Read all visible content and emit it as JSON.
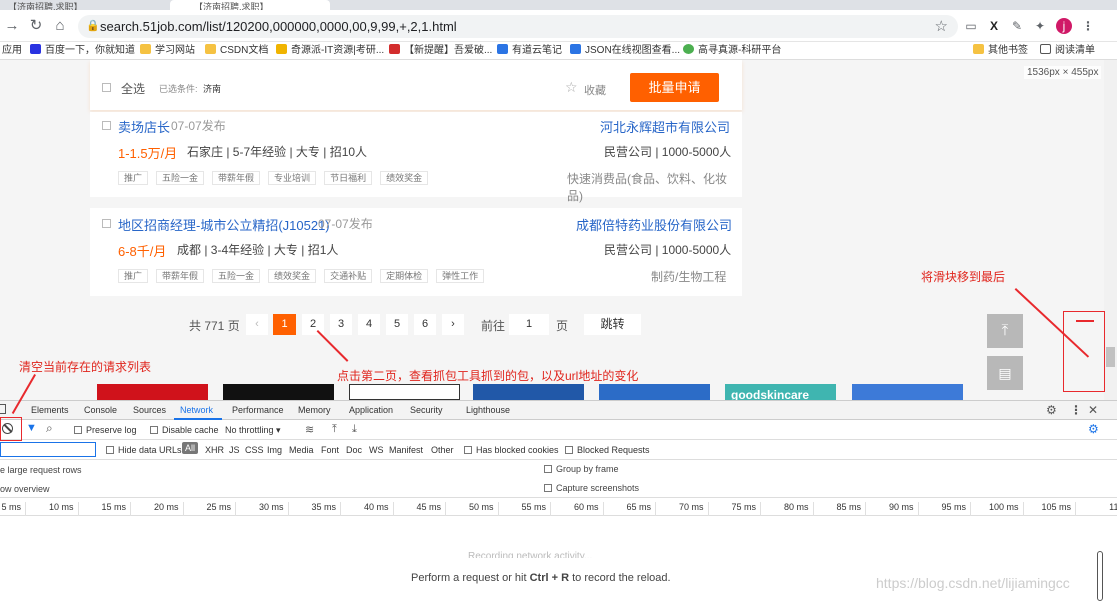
{
  "browser": {
    "tabs": [
      "【济南招聘,求职】",
      "【济南招聘,求职】"
    ],
    "url": "search.51job.com/list/120200,000000,0000,00,9,99,+,2,1.html",
    "profile_initial": "j",
    "bookmarks": [
      "应用",
      "百度一下，你就知道",
      "学习网站",
      "CSDN文档",
      "奇源派-IT资源|考研...",
      "【新提醒】吾爱破...",
      "有道云笔记",
      "JSON在线视图查看...",
      "高寻真源-科研平台",
      "其他书签",
      "阅读清单"
    ],
    "viewport_size": "1536px × 455px"
  },
  "page": {
    "select_all": "全选",
    "filter_label": "已选条件:",
    "filter_value": "济南",
    "favorite": "收藏",
    "batch_apply": "批量申请",
    "jobs": [
      {
        "title": "卖场店长",
        "date": "07-07发布",
        "company": "河北永辉超市有限公司",
        "salary": "1-1.5万/月",
        "info": "石家庄 | 5-7年经验 | 大专 | 招10人",
        "company_info": "民营公司 | 1000-5000人",
        "tags": [
          "推广",
          "五险一金",
          "带薪年假",
          "专业培训",
          "节日福利",
          "绩效奖金"
        ],
        "industry": "快速消费品(食品、饮料、化妆品)"
      },
      {
        "title": "地区招商经理-城市公立精招(J10521)",
        "date": "07-07发布",
        "company": "成都倍特药业股份有限公司",
        "salary": "6-8千/月",
        "info": "成都 | 3-4年经验 | 大专 | 招1人",
        "company_info": "民营公司 | 1000-5000人",
        "tags": [
          "推广",
          "带薪年假",
          "五险一金",
          "绩效奖金",
          "交通补贴",
          "定期体检",
          "弹性工作"
        ],
        "industry": "制药/生物工程"
      }
    ],
    "pagination": {
      "total": "共 771 页",
      "prev": "‹",
      "pages": [
        "1",
        "2",
        "3",
        "4",
        "5",
        "6"
      ],
      "current": "1",
      "next": "›",
      "goto_label": "前往",
      "goto_value": "1",
      "page_unit": "页",
      "jump": "跳转"
    },
    "banner_text": "goodskincare"
  },
  "annotations": {
    "slider": "将滑块移到最后",
    "page2": "点击第二页，查看抓包工具抓到的包，以及url地址的变化",
    "clear": "清空当前存在的请求列表"
  },
  "devtools": {
    "tabs": [
      "Elements",
      "Console",
      "Sources",
      "Network",
      "Performance",
      "Memory",
      "Application",
      "Security",
      "Lighthouse"
    ],
    "active_tab": "Network",
    "preserve_log": "Preserve log",
    "disable_cache": "Disable cache",
    "throttling": "No throttling",
    "hide_data_urls": "Hide data URLs",
    "filter_types": [
      "All",
      "XHR",
      "JS",
      "CSS",
      "Img",
      "Media",
      "Font",
      "Doc",
      "WS",
      "Manifest",
      "Other"
    ],
    "has_blocked_cookies": "Has blocked cookies",
    "blocked_requests": "Blocked Requests",
    "use_large_rows": "e large request rows",
    "group_by_frame": "Group by frame",
    "show_overview": "ow overview",
    "capture_screenshots": "Capture screenshots",
    "ticks": [
      "5 ms",
      "10 ms",
      "15 ms",
      "20 ms",
      "25 ms",
      "30 ms",
      "35 ms",
      "40 ms",
      "45 ms",
      "50 ms",
      "55 ms",
      "60 ms",
      "65 ms",
      "70 ms",
      "75 ms",
      "80 ms",
      "85 ms",
      "90 ms",
      "95 ms",
      "100 ms",
      "105 ms",
      "110"
    ],
    "recording": "Recording network activity...",
    "hint_prefix": "Perform a request or hit ",
    "hint_keys": "Ctrl + R",
    "hint_suffix": " to record the reload."
  },
  "watermark": "https://blog.csdn.net/lijiamingcc"
}
